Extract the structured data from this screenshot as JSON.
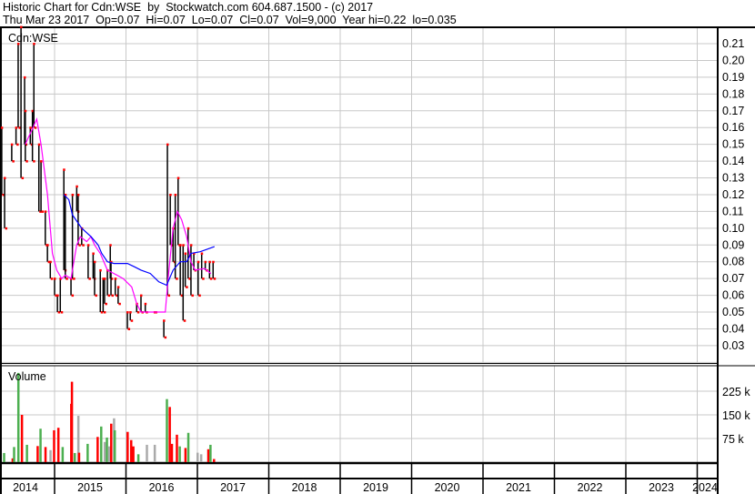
{
  "header": {
    "line1": "Historic Chart for Cdn:WSE  by  Stockwatch.com 604.687.1500 - (c) 2017",
    "line2": "Thu Mar 23 2017  Op=0.07  Hi=0.07  Lo=0.07  Cl=0.07  Vol=9,000  Year hi=0.22  lo=0.035"
  },
  "chart_data": {
    "type": "bar",
    "symbol_label": "Cdn:WSE",
    "volume_label": "Volume",
    "price_ticks": [
      "0.21",
      "0.20",
      "0.19",
      "0.18",
      "0.17",
      "0.16",
      "0.15",
      "0.14",
      "0.13",
      "0.12",
      "0.11",
      "0.10",
      "0.09",
      "0.08",
      "0.07",
      "0.06",
      "0.05",
      "0.04",
      "0.03"
    ],
    "volume_ticks": [
      "225 k",
      "150 k",
      "75 k"
    ],
    "volume_tick_values": [
      225,
      150,
      75
    ],
    "year_labels": [
      "2014",
      "2015",
      "2016",
      "2017",
      "2018",
      "2019",
      "2020",
      "2021",
      "2022",
      "2023",
      "2024"
    ],
    "x_range_years": [
      2013.77,
      2024.3
    ],
    "price_range": [
      0.02,
      0.22
    ],
    "grid": true,
    "colors": {
      "bar": "#000000",
      "tick": "#ff0000",
      "ma_short": "#ff00ff",
      "ma_long": "#0000ff",
      "vol_up": "#4caf50",
      "vol_down": "#ff0000",
      "vol_flat": "#aaaaaa",
      "grid": "#c8c8c8"
    },
    "price_bars_date_high_low": [
      [
        2014.26,
        0.16,
        0.12
      ],
      [
        2014.3,
        0.13,
        0.1
      ],
      [
        2014.4,
        0.15,
        0.14
      ],
      [
        2014.46,
        0.16,
        0.15
      ],
      [
        2014.49,
        0.21,
        0.16
      ],
      [
        2014.53,
        0.22,
        0.13
      ],
      [
        2014.58,
        0.19,
        0.15
      ],
      [
        2014.59,
        0.17,
        0.14
      ],
      [
        2014.66,
        0.16,
        0.15
      ],
      [
        2014.69,
        0.17,
        0.14
      ],
      [
        2014.71,
        0.21,
        0.16
      ],
      [
        2014.78,
        0.15,
        0.11
      ],
      [
        2014.81,
        0.14,
        0.11
      ],
      [
        2014.87,
        0.11,
        0.09
      ],
      [
        2014.9,
        0.09,
        0.08
      ],
      [
        2014.94,
        0.08,
        0.07
      ],
      [
        2015.0,
        0.07,
        0.06
      ],
      [
        2015.04,
        0.06,
        0.05
      ],
      [
        2015.08,
        0.07,
        0.05
      ],
      [
        2015.13,
        0.135,
        0.075
      ],
      [
        2015.15,
        0.12,
        0.07
      ],
      [
        2015.23,
        0.07,
        0.06
      ],
      [
        2015.25,
        0.12,
        0.07
      ],
      [
        2015.31,
        0.125,
        0.11
      ],
      [
        2015.33,
        0.12,
        0.09
      ],
      [
        2015.38,
        0.1,
        0.09
      ],
      [
        2015.47,
        0.09,
        0.07
      ],
      [
        2015.54,
        0.085,
        0.07
      ],
      [
        2015.56,
        0.08,
        0.06
      ],
      [
        2015.64,
        0.075,
        0.05
      ],
      [
        2015.68,
        0.07,
        0.05
      ],
      [
        2015.7,
        0.07,
        0.055
      ],
      [
        2015.74,
        0.075,
        0.06
      ],
      [
        2015.78,
        0.09,
        0.07
      ],
      [
        2015.79,
        0.08,
        0.06
      ],
      [
        2015.85,
        0.07,
        0.06
      ],
      [
        2015.89,
        0.065,
        0.055
      ],
      [
        2016.02,
        0.05,
        0.04
      ],
      [
        2016.06,
        0.05,
        0.045
      ],
      [
        2016.15,
        0.055,
        0.05
      ],
      [
        2016.21,
        0.06,
        0.05
      ],
      [
        2016.27,
        0.055,
        0.05
      ],
      [
        2016.4,
        0.05,
        0.05
      ],
      [
        2016.53,
        0.045,
        0.035
      ],
      [
        2016.58,
        0.15,
        0.06
      ],
      [
        2016.62,
        0.12,
        0.09
      ],
      [
        2016.66,
        0.1,
        0.08
      ],
      [
        2016.69,
        0.12,
        0.07
      ],
      [
        2016.73,
        0.13,
        0.09
      ],
      [
        2016.76,
        0.09,
        0.06
      ],
      [
        2016.8,
        0.09,
        0.045
      ],
      [
        2016.83,
        0.085,
        0.065
      ],
      [
        2016.87,
        0.1,
        0.07
      ],
      [
        2016.91,
        0.09,
        0.06
      ],
      [
        2016.95,
        0.085,
        0.075
      ],
      [
        2017.01,
        0.08,
        0.06
      ],
      [
        2017.06,
        0.085,
        0.07
      ],
      [
        2017.11,
        0.08,
        0.075
      ],
      [
        2017.17,
        0.08,
        0.07
      ],
      [
        2017.22,
        0.08,
        0.07
      ]
    ],
    "ma_short": [
      [
        2014.59,
        0.15
      ],
      [
        2014.75,
        0.165
      ],
      [
        2014.81,
        0.15
      ],
      [
        2014.9,
        0.12
      ],
      [
        2014.97,
        0.085
      ],
      [
        2015.03,
        0.075
      ],
      [
        2015.1,
        0.07
      ],
      [
        2015.15,
        0.072
      ],
      [
        2015.23,
        0.07
      ],
      [
        2015.31,
        0.09
      ],
      [
        2015.36,
        0.095
      ],
      [
        2015.45,
        0.092
      ],
      [
        2015.51,
        0.095
      ],
      [
        2015.56,
        0.09
      ],
      [
        2015.64,
        0.085
      ],
      [
        2015.74,
        0.075
      ],
      [
        2015.83,
        0.073
      ],
      [
        2015.96,
        0.07
      ],
      [
        2016.08,
        0.065
      ],
      [
        2016.15,
        0.055
      ],
      [
        2016.21,
        0.05
      ],
      [
        2016.4,
        0.05
      ],
      [
        2016.55,
        0.05
      ],
      [
        2016.59,
        0.07
      ],
      [
        2016.66,
        0.1
      ],
      [
        2016.72,
        0.11
      ],
      [
        2016.78,
        0.105
      ],
      [
        2016.85,
        0.095
      ],
      [
        2016.91,
        0.08
      ],
      [
        2016.97,
        0.075
      ],
      [
        2017.1,
        0.076
      ],
      [
        2017.19,
        0.073
      ]
    ],
    "ma_long": [
      [
        2015.13,
        0.12
      ],
      [
        2015.2,
        0.117
      ],
      [
        2015.25,
        0.108
      ],
      [
        2015.38,
        0.1
      ],
      [
        2015.51,
        0.095
      ],
      [
        2015.61,
        0.09
      ],
      [
        2015.66,
        0.085
      ],
      [
        2015.74,
        0.08
      ],
      [
        2015.83,
        0.079
      ],
      [
        2016.02,
        0.079
      ],
      [
        2016.12,
        0.077
      ],
      [
        2016.21,
        0.075
      ],
      [
        2016.34,
        0.073
      ],
      [
        2016.46,
        0.068
      ],
      [
        2016.57,
        0.066
      ],
      [
        2016.66,
        0.075
      ],
      [
        2016.76,
        0.08
      ],
      [
        2016.85,
        0.08
      ],
      [
        2016.91,
        0.085
      ],
      [
        2017.04,
        0.086
      ],
      [
        2017.24,
        0.089
      ]
    ],
    "volume_k_date_value_dir": [
      [
        2014.29,
        29,
        "up"
      ],
      [
        2014.41,
        12,
        "down"
      ],
      [
        2014.43,
        48,
        "up"
      ],
      [
        2014.49,
        283,
        "up"
      ],
      [
        2014.54,
        150,
        "down"
      ],
      [
        2014.61,
        55,
        "up"
      ],
      [
        2014.76,
        51,
        "down"
      ],
      [
        2014.8,
        106,
        "up"
      ],
      [
        2014.87,
        48,
        "down"
      ],
      [
        2014.94,
        38,
        "flat"
      ],
      [
        2014.99,
        101,
        "down"
      ],
      [
        2015.05,
        109,
        "down"
      ],
      [
        2015.11,
        48,
        "up"
      ],
      [
        2015.23,
        185,
        "down"
      ],
      [
        2015.24,
        255,
        "down"
      ],
      [
        2015.28,
        29,
        "up"
      ],
      [
        2015.33,
        147,
        "flat"
      ],
      [
        2015.34,
        30,
        "down"
      ],
      [
        2015.46,
        58,
        "up"
      ],
      [
        2015.6,
        80,
        "down"
      ],
      [
        2015.65,
        113,
        "up"
      ],
      [
        2015.7,
        64,
        "flat"
      ],
      [
        2015.73,
        78,
        "up"
      ],
      [
        2015.76,
        50,
        "flat"
      ],
      [
        2015.79,
        122,
        "down"
      ],
      [
        2015.83,
        139,
        "flat"
      ],
      [
        2015.84,
        101,
        "up"
      ],
      [
        2016.02,
        96,
        "down"
      ],
      [
        2016.07,
        70,
        "down"
      ],
      [
        2016.1,
        50,
        "down"
      ],
      [
        2016.17,
        25,
        "up"
      ],
      [
        2016.29,
        55,
        "flat"
      ],
      [
        2016.4,
        55,
        "flat"
      ],
      [
        2016.57,
        200,
        "up"
      ],
      [
        2016.61,
        175,
        "down"
      ],
      [
        2016.64,
        58,
        "down"
      ],
      [
        2016.71,
        87,
        "down"
      ],
      [
        2016.75,
        50,
        "up"
      ],
      [
        2016.83,
        45,
        "down"
      ],
      [
        2016.87,
        93,
        "up"
      ],
      [
        2017.0,
        30,
        "flat"
      ],
      [
        2017.05,
        25,
        "flat"
      ],
      [
        2017.15,
        41,
        "down"
      ],
      [
        2017.18,
        55,
        "up"
      ],
      [
        2017.23,
        10,
        "down"
      ]
    ]
  }
}
